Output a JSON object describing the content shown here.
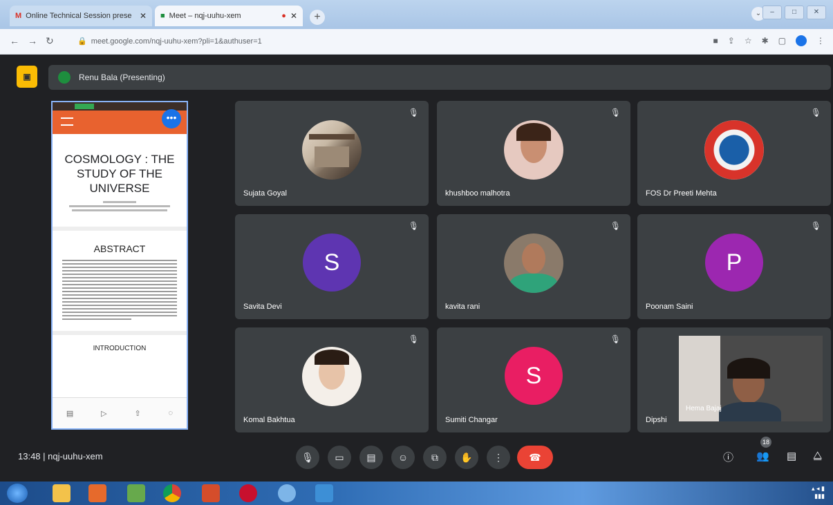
{
  "browser": {
    "tabs": [
      {
        "label": "Online Technical Session prese",
        "active": false
      },
      {
        "label": "Meet – nqj-uuhu-xem",
        "active": true
      }
    ],
    "new_tab": "+",
    "url": "meet.google.com/nqj-uuhu-xem?pli=1&authuser=1"
  },
  "meet": {
    "presenter_label": "Renu Bala (Presenting)",
    "meeting_code": "13:48  |  nqj-uuhu-xem",
    "participant_badge": "18",
    "accent_end_call": "#ea4335"
  },
  "shared_doc": {
    "title": "COSMOLOGY : THE STUDY OF THE UNIVERSE",
    "abstract_heading": "ABSTRACT",
    "intro_heading": "INTRODUCTION"
  },
  "participants": [
    {
      "name": "Sujata Goyal",
      "avatar": "photo-building"
    },
    {
      "name": "khushboo malhotra",
      "avatar": "photo-woman"
    },
    {
      "name": "FOS Dr Preeti Mehta",
      "avatar": "emblem"
    },
    {
      "name": "Savita Devi",
      "avatar": "letter",
      "letter": "S",
      "color": "#5e35b1"
    },
    {
      "name": "kavita rani",
      "avatar": "photo-woman-green"
    },
    {
      "name": "Poonam Saini",
      "avatar": "letter",
      "letter": "P",
      "color": "#9c27b0"
    },
    {
      "name": "Komal Bakhtua",
      "avatar": "photo-woman-light"
    },
    {
      "name": "Sumiti Changar",
      "avatar": "letter",
      "letter": "S",
      "color": "#e91e63"
    },
    {
      "name": "Dipshi",
      "avatar": "self-view"
    }
  ],
  "self_view_name": "Hema Bajaj"
}
